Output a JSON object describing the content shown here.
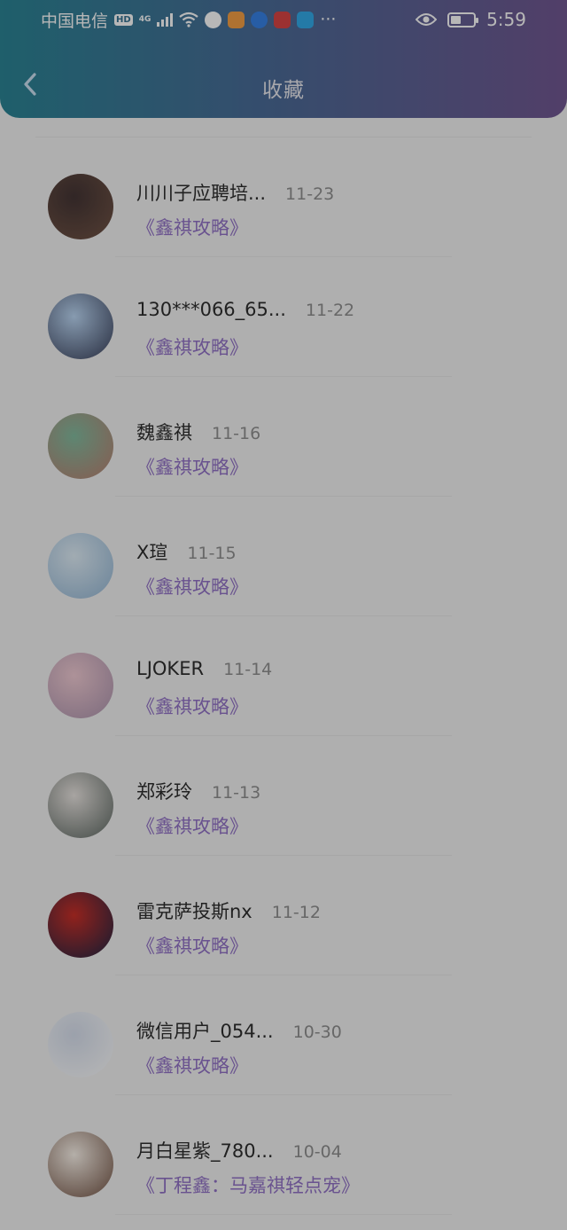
{
  "status_bar": {
    "carrier": "中国电信",
    "hd": "HD",
    "network": "4G",
    "time": "5:59",
    "more": "···"
  },
  "header": {
    "title": "收藏"
  },
  "items": [
    {
      "name": "川川子应聘培...",
      "date": "11-23",
      "subtitle": "《鑫祺攻略》",
      "avatar_colors": [
        "#3a2a2a",
        "#6b4b3b"
      ]
    },
    {
      "name": "130***066_65...",
      "date": "11-22",
      "subtitle": "《鑫祺攻略》",
      "avatar_colors": [
        "#b9d6f5",
        "#2d3550"
      ]
    },
    {
      "name": "魏鑫祺",
      "date": "11-16",
      "subtitle": "《鑫祺攻略》",
      "avatar_colors": [
        "#7cb89a",
        "#b97a6a"
      ]
    },
    {
      "name": "X瑄",
      "date": "11-15",
      "subtitle": "《鑫祺攻略》",
      "avatar_colors": [
        "#dfeef8",
        "#8fb4d4"
      ]
    },
    {
      "name": "LJOKER",
      "date": "11-14",
      "subtitle": "《鑫祺攻略》",
      "avatar_colors": [
        "#f1c9d2",
        "#a98faa"
      ]
    },
    {
      "name": "郑彩玲",
      "date": "11-13",
      "subtitle": "《鑫祺攻略》",
      "avatar_colors": [
        "#e9e4e0",
        "#55605a"
      ]
    },
    {
      "name": "雷克萨投斯nx",
      "date": "11-12",
      "subtitle": "《鑫祺攻略》",
      "avatar_colors": [
        "#c8241c",
        "#101a3a"
      ]
    },
    {
      "name": "微信用户_054...",
      "date": "10-30",
      "subtitle": "《鑫祺攻略》",
      "avatar_colors": [
        "#d7dfee",
        "#ffffff"
      ]
    },
    {
      "name": "月白星紫_780...",
      "date": "10-04",
      "subtitle": "《丁程鑫：马嘉祺轻点宠》",
      "avatar_colors": [
        "#fbf3ea",
        "#6b4a3a"
      ]
    }
  ],
  "colors": {
    "header_gradient_start": "#1f7e90",
    "header_gradient_end": "#6a4e8c",
    "subtitle": "#8d6bc4",
    "background": "#f3f3f3"
  }
}
